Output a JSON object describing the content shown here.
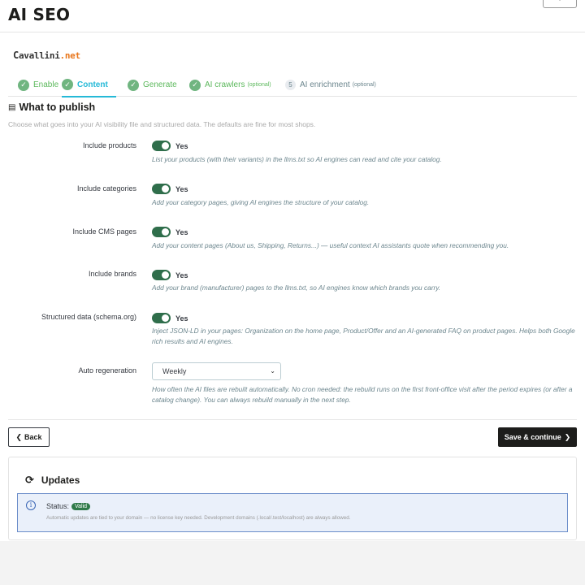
{
  "header": {
    "title": "AI SEO"
  },
  "logo": {
    "first_letter": "C",
    "name_rest": "avallini",
    "tld": ".net"
  },
  "steps": [
    {
      "label": "Enable",
      "state": "done"
    },
    {
      "label": "Content",
      "state": "active"
    },
    {
      "label": "Generate",
      "state": "done"
    },
    {
      "label": "AI crawlers",
      "optional": "(optional)",
      "state": "done"
    },
    {
      "label": "AI enrichment",
      "optional": "(optional)",
      "number": "5",
      "state": "pending"
    }
  ],
  "section": {
    "title": "What to publish",
    "description": "Choose what goes into your AI visibility file and structured data. The defaults are fine for most shops."
  },
  "fields": [
    {
      "label": "Include products",
      "value": "Yes",
      "enabled": true,
      "help": "List your products (with their variants) in the llms.txt so AI engines can read and cite your catalog."
    },
    {
      "label": "Include categories",
      "value": "Yes",
      "enabled": true,
      "help": "Add your category pages, giving AI engines the structure of your catalog."
    },
    {
      "label": "Include CMS pages",
      "value": "Yes",
      "enabled": true,
      "help": "Add your content pages (About us, Shipping, Returns...) — useful context AI assistants quote when recommending you."
    },
    {
      "label": "Include brands",
      "value": "Yes",
      "enabled": true,
      "help": "Add your brand (manufacturer) pages to the llms.txt, so AI engines know which brands you carry."
    },
    {
      "label": "Structured data (schema.org)",
      "value": "Yes",
      "enabled": true,
      "help": "Inject JSON-LD in your pages: Organization on the home page, Product/Offer and an AI-generated FAQ on product pages. Helps both Google rich results and AI engines."
    }
  ],
  "auto_regeneration": {
    "label": "Auto regeneration",
    "selected": "Weekly",
    "help": "How often the AI files are rebuilt automatically. No cron needed: the rebuild runs on the first front-office visit after the period expires (or after a catalog change). You can always rebuild manually in the next step."
  },
  "buttons": {
    "back": "Back",
    "save": "Save & continue"
  },
  "updates": {
    "title": "Updates",
    "status_label": "Status:",
    "status_badge": "Valid",
    "note": "Automatic updates are tied to your domain — no license key needed. Development domains (.local/.test/localhost) are always allowed."
  },
  "colors": {
    "accent": "#25b9d7",
    "success": "#70b580",
    "switch_on": "#2f6e4b",
    "primary_button": "#1d1d1b"
  }
}
